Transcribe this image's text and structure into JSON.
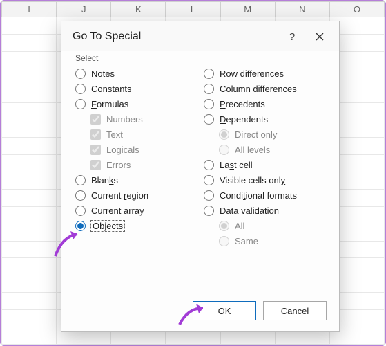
{
  "columns": [
    "I",
    "J",
    "K",
    "L",
    "M",
    "N",
    "O"
  ],
  "dialog": {
    "title": "Go To Special",
    "section_label": "Select",
    "left_options": {
      "notes": "Notes",
      "constants": "Constants",
      "formulas": "Formulas",
      "formula_numbers": "Numbers",
      "formula_text": "Text",
      "formula_logicals": "Logicals",
      "formula_errors": "Errors",
      "blanks": "Blanks",
      "current_region": "Current region",
      "current_array": "Current array",
      "objects": "Objects"
    },
    "right_options": {
      "row_diff": "Row differences",
      "col_diff": "Column differences",
      "precedents": "Precedents",
      "dependents": "Dependents",
      "direct_only": "Direct only",
      "all_levels": "All levels",
      "last_cell": "Last cell",
      "visible_cells": "Visible cells only",
      "cond_formats": "Conditional formats",
      "data_validation": "Data validation",
      "dv_all": "All",
      "dv_same": "Same"
    },
    "buttons": {
      "ok": "OK",
      "cancel": "Cancel"
    }
  }
}
